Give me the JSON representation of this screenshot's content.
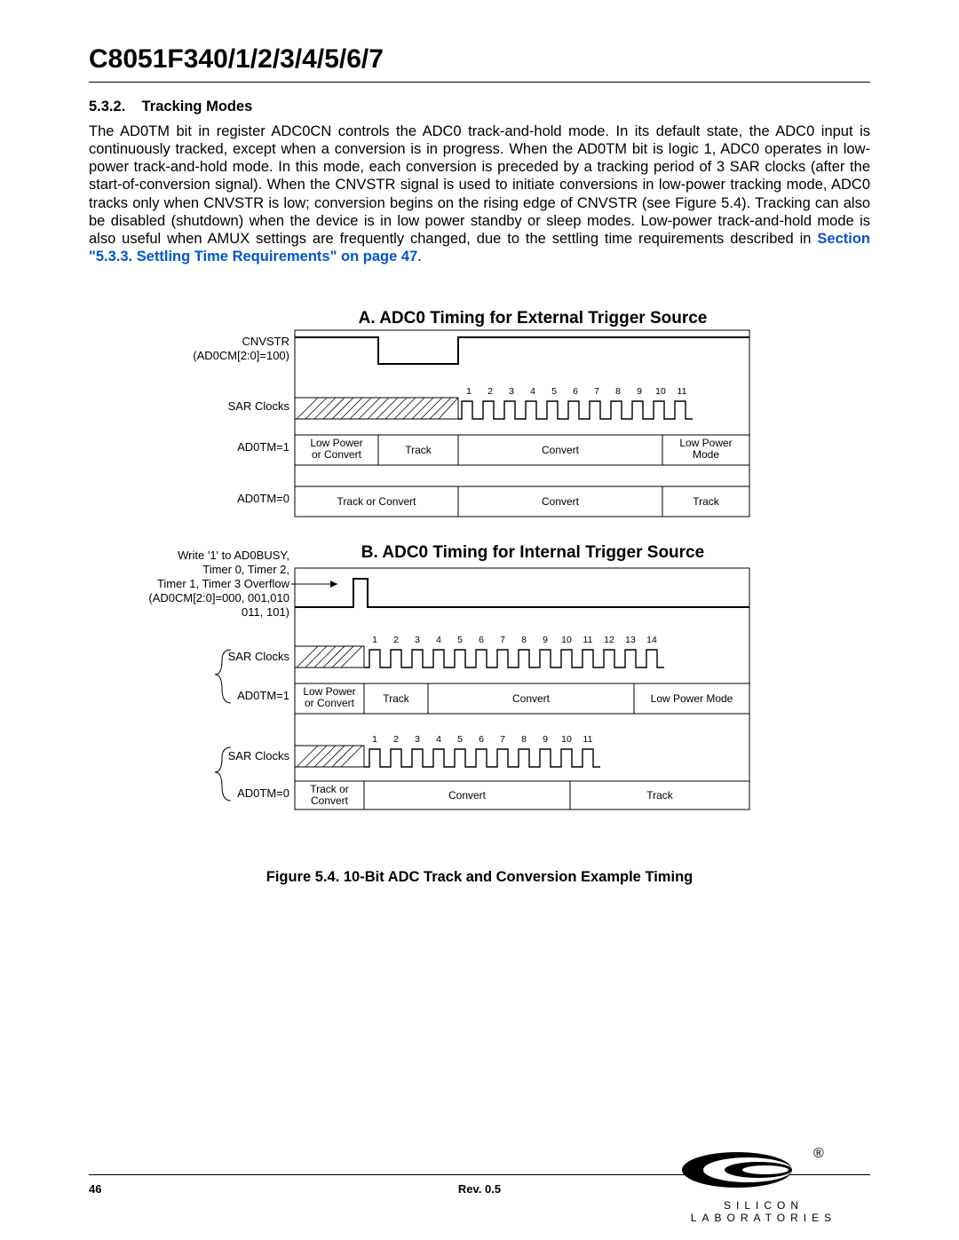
{
  "doc_title": "C8051F340/1/2/3/4/5/6/7",
  "section_number": "5.3.2.",
  "section_title": "Tracking Modes",
  "body_part1": "The AD0TM bit in register ADC0CN controls the ADC0 track-and-hold mode. In its default state, the ADC0 input is continuously tracked, except when a conversion is in progress. When the AD0TM bit is logic 1, ADC0 operates in low-power track-and-hold mode. In this mode, each conversion is preceded by a tracking period of 3 SAR clocks (after the start-of-conversion signal). When the CNVSTR signal is used to initiate conversions in low-power tracking mode, ADC0 tracks only when CNVSTR is low; conversion begins on the rising edge of CNVSTR (see Figure 5.4). Tracking can also be disabled (shutdown) when the device is in low power standby or sleep modes. Low-power track-and-hold mode is also useful when AMUX settings are frequently changed, due to the settling time requirements described in ",
  "xref_text": "Section \"5.3.3. Settling Time Requirements\" on page 47",
  "body_part2": ".",
  "figure": {
    "title_a": "A. ADC0 Timing for External Trigger Source",
    "title_b": "B. ADC0 Timing for Internal Trigger Source",
    "caption": "Figure 5.4. 10-Bit ADC Track and Conversion Example Timing",
    "a": {
      "cnvstr_label": "CNVSTR",
      "cnvstr_sub": "(AD0CM[2:0]=100)",
      "sar_label": "SAR Clocks",
      "ad0tm1_label": "AD0TM=1",
      "ad0tm0_label": "AD0TM=0",
      "ticks": [
        "1",
        "2",
        "3",
        "4",
        "5",
        "6",
        "7",
        "8",
        "9",
        "10",
        "11"
      ],
      "row1": [
        "Low Power or Convert",
        "Track",
        "Convert",
        "Low Power Mode"
      ],
      "row2": [
        "Track or Convert",
        "Convert",
        "Track"
      ]
    },
    "b": {
      "trigger_lines": [
        "Write '1' to AD0BUSY,",
        "Timer 0, Timer 2,",
        "Timer 1, Timer 3  Overflow",
        "(AD0CM[2:0]=000, 001,010",
        "011, 101)"
      ],
      "sar_label": "SAR Clocks",
      "ad0tm1_label": "AD0TM=1",
      "ad0tm0_label": "AD0TM=0",
      "ticks1": [
        "1",
        "2",
        "3",
        "4",
        "5",
        "6",
        "7",
        "8",
        "9",
        "10",
        "11",
        "12",
        "13",
        "14"
      ],
      "ticks2": [
        "1",
        "2",
        "3",
        "4",
        "5",
        "6",
        "7",
        "8",
        "9",
        "10",
        "11"
      ],
      "row1": [
        "Low Power or Convert",
        "Track",
        "Convert",
        "Low Power Mode"
      ],
      "row2": [
        "Track or Convert",
        "Convert",
        "Track"
      ]
    }
  },
  "footer": {
    "page": "46",
    "rev": "Rev. 0.5",
    "brand": "SILICON LABORATORIES"
  }
}
